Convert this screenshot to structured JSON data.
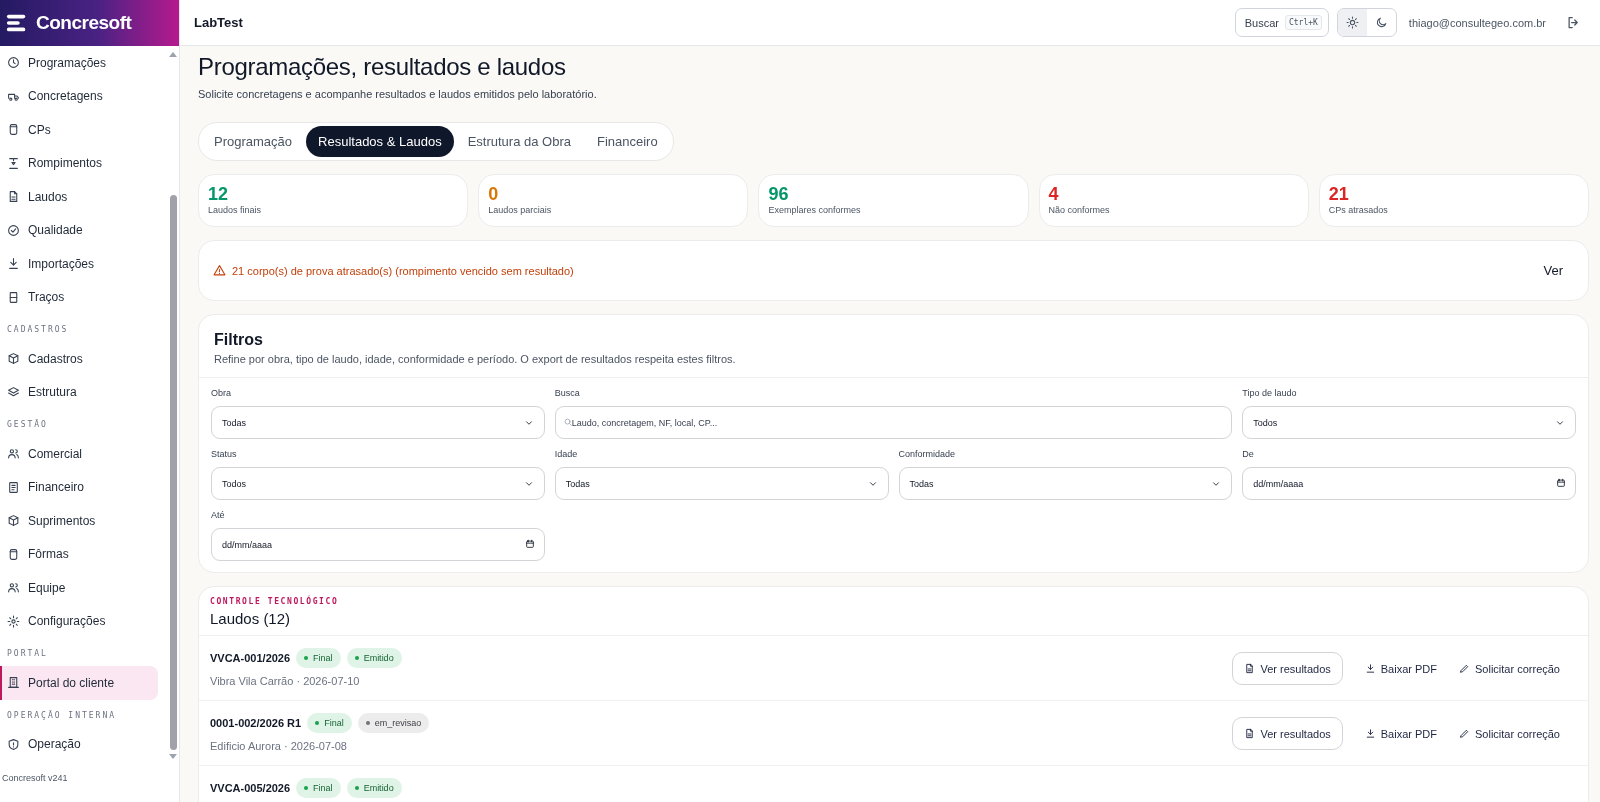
{
  "brand": {
    "name": "Concresoft"
  },
  "sidebar": {
    "sections": [
      {
        "items": [
          {
            "label": "Programações",
            "selected": false
          },
          {
            "label": "Concretagens",
            "selected": false
          },
          {
            "label": "CPs",
            "selected": false
          },
          {
            "label": "Rompimentos",
            "selected": false
          },
          {
            "label": "Laudos",
            "selected": false
          },
          {
            "label": "Qualidade",
            "selected": false
          },
          {
            "label": "Importações",
            "selected": false
          },
          {
            "label": "Traços",
            "selected": false
          }
        ]
      },
      {
        "title": "CADASTROS",
        "items": [
          {
            "label": "Cadastros",
            "selected": false
          },
          {
            "label": "Estrutura",
            "selected": false
          }
        ]
      },
      {
        "title": "GESTÃO",
        "items": [
          {
            "label": "Comercial",
            "selected": false
          },
          {
            "label": "Financeiro",
            "selected": false
          },
          {
            "label": "Suprimentos",
            "selected": false
          },
          {
            "label": "Fôrmas",
            "selected": false
          },
          {
            "label": "Equipe",
            "selected": false
          },
          {
            "label": "Configurações",
            "selected": false
          }
        ]
      },
      {
        "title": "PORTAL",
        "items": [
          {
            "label": "Portal do cliente",
            "selected": true
          }
        ]
      },
      {
        "title": "OPERAÇÃO INTERNA",
        "items": [
          {
            "label": "Operação",
            "selected": false
          }
        ]
      }
    ],
    "footer": "Concresoft v241"
  },
  "header": {
    "title": "LabTest",
    "search": {
      "label": "Buscar",
      "shortcut": "Ctrl+K"
    },
    "theme_options": [
      {
        "selected": true
      },
      {
        "selected": false
      }
    ],
    "user_email": "thiago@consultegeo.com.br"
  },
  "page": {
    "title": "Programações, resultados e laudos",
    "subtitle": "Solicite concretagens e acompanhe resultados e laudos emitidos pelo laboratório."
  },
  "tabs": [
    {
      "label": "Programação",
      "selected": false
    },
    {
      "label": "Resultados & Laudos",
      "selected": true
    },
    {
      "label": "Estrutura da Obra",
      "selected": false
    },
    {
      "label": "Financeiro",
      "selected": false
    }
  ],
  "stats": [
    {
      "value": "12",
      "label": "Laudos finais",
      "color": "#059669"
    },
    {
      "value": "0",
      "label": "Laudos parciais",
      "color": "#d97706"
    },
    {
      "value": "96",
      "label": "Exemplares conformes",
      "color": "#059669"
    },
    {
      "value": "4",
      "label": "Não conformes",
      "color": "#dc2626"
    },
    {
      "value": "21",
      "label": "CPs atrasados",
      "color": "#dc2626"
    }
  ],
  "alert": {
    "text": "21 corpo(s) de prova atrasado(s) (rompimento vencido sem resultado)",
    "action": "Ver"
  },
  "filters": {
    "title": "Filtros",
    "description": "Refine por obra, tipo de laudo, idade, conformidade e período. O export de resultados respeita estes filtros.",
    "fields": [
      {
        "label": "Obra",
        "kind": "select",
        "value": "Todas"
      },
      {
        "label": "Busca",
        "kind": "search",
        "placeholder": "Laudo, concretagem, NF, local, CP..."
      },
      {
        "label": "Tipo de laudo",
        "kind": "select",
        "value": "Todos"
      },
      {
        "label": "Status",
        "kind": "select",
        "value": "Todos"
      },
      {
        "label": "Idade",
        "kind": "select",
        "value": "Todas"
      },
      {
        "label": "Conformidade",
        "kind": "select",
        "value": "Todas"
      },
      {
        "label": "De",
        "kind": "date",
        "placeholder": "dd/mm/aaaa"
      },
      {
        "label": "Até",
        "kind": "date",
        "placeholder": "dd/mm/aaaa"
      }
    ]
  },
  "laudos": {
    "eyebrow": "CONTROLE TECNOLÓGICO",
    "title": "Laudos (12)",
    "rows": [
      {
        "code": "VVCA-001/2026",
        "badges": [
          {
            "label": "Final",
            "color": "#16a34a"
          },
          {
            "label": "Emitido",
            "color": "#16a34a"
          }
        ],
        "meta": "Vibra Vila Carrão · 2026-07-10",
        "actions": [
          {
            "label": "Ver resultados",
            "kind": "outline"
          },
          {
            "label": "Baixar PDF",
            "kind": "download"
          },
          {
            "label": "Solicitar correção",
            "kind": "edit"
          }
        ]
      },
      {
        "code": "0001-002/2026 R1",
        "badges": [
          {
            "label": "Final",
            "color": "#16a34a"
          },
          {
            "label": "em_revisao",
            "color": "#71717a"
          }
        ],
        "meta": "Edificio Aurora · 2026-07-08",
        "actions": [
          {
            "label": "Ver resultados",
            "kind": "outline"
          },
          {
            "label": "Baixar PDF",
            "kind": "download"
          },
          {
            "label": "Solicitar correção",
            "kind": "edit"
          }
        ]
      },
      {
        "code": "VVCA-005/2026",
        "badges": [
          {
            "label": "Final",
            "color": "#16a34a"
          },
          {
            "label": "Emitido",
            "color": "#16a34a"
          }
        ]
      }
    ]
  }
}
